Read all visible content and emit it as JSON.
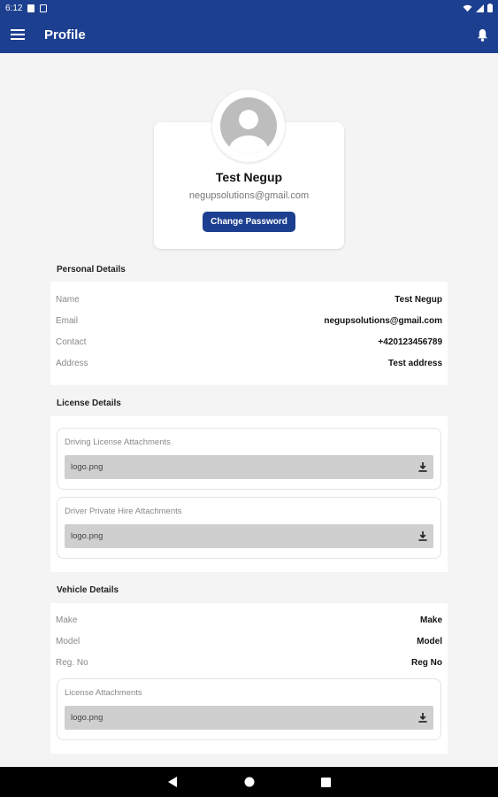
{
  "status_bar": {
    "time": "6:12"
  },
  "app_bar": {
    "title": "Profile"
  },
  "profile": {
    "name": "Test Negup",
    "email": "negupsolutions@gmail.com",
    "change_password_label": "Change Password"
  },
  "personal": {
    "title": "Personal Details",
    "rows": [
      {
        "label": "Name",
        "value": "Test Negup"
      },
      {
        "label": "Email",
        "value": "negupsolutions@gmail.com"
      },
      {
        "label": "Contact",
        "value": "+420123456789"
      },
      {
        "label": "Address",
        "value": "Test address"
      }
    ]
  },
  "license": {
    "title": "License Details",
    "attachments": [
      {
        "label": "Driving License Attachments",
        "file": "logo.png"
      },
      {
        "label": "Driver Private Hire Attachments",
        "file": "logo.png"
      }
    ]
  },
  "vehicle": {
    "title": "Vehicle Details",
    "rows": [
      {
        "label": "Make",
        "value": "Make"
      },
      {
        "label": "Model",
        "value": "Model"
      },
      {
        "label": "Reg. No",
        "value": "Reg No"
      }
    ],
    "attachment": {
      "label": "License Attachments",
      "file": "logo.png"
    }
  },
  "icons": {
    "menu": "hamburger-menu-icon",
    "bell": "notification-bell-icon",
    "download": "download-icon",
    "avatar": "user-avatar-icon"
  },
  "colors": {
    "primary": "#1d3f8f",
    "background": "#f4f4f4",
    "file_row": "#cfcfcf"
  }
}
